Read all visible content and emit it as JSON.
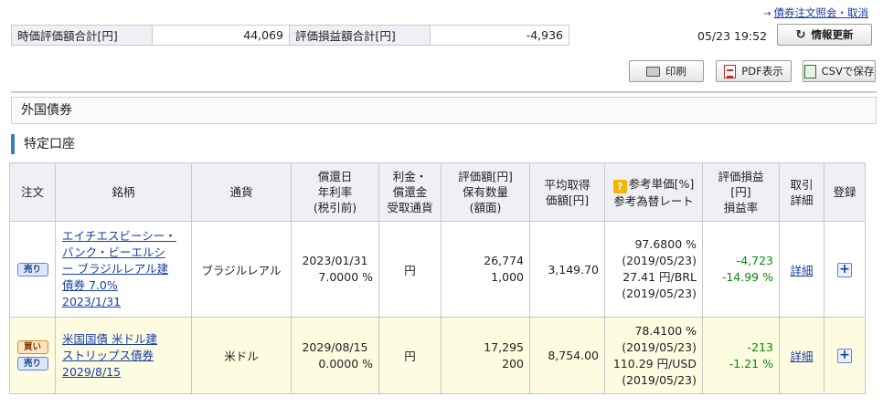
{
  "header": {
    "top_link": "債券注文照会・取消",
    "timestamp": "05/23 19:52",
    "refresh_label": "情報更新",
    "print_label": "印刷",
    "pdf_label": "PDF表示",
    "csv_label": "CSVで保存"
  },
  "summary": {
    "market_value_label": "時価評価額合計[円]",
    "market_value": "44,069",
    "pl_label": "評価損益額合計[円]",
    "pl_value": "-4,936"
  },
  "section_title": "外国債券",
  "account_title": "特定口座",
  "columns": {
    "order": "注文",
    "name": "銘柄",
    "currency": "通貨",
    "redemption_1": "償還日",
    "redemption_2": "年利率",
    "redemption_3": "(税引前)",
    "interest_1": "利金・",
    "interest_2": "償還金",
    "interest_3": "受取通貨",
    "value_1": "評価額[円]",
    "value_2": "保有数量",
    "value_3": "(額面)",
    "avg_1": "平均取得",
    "avg_2": "価額[円]",
    "ref_1": "参考単価[%]",
    "ref_2": "参考為替レート",
    "pl_1": "評価損益",
    "pl_2": "[円]",
    "pl_3": "損益率",
    "detail_1": "取引",
    "detail_2": "詳細",
    "register": "登録"
  },
  "rows": [
    {
      "sell_label": "売り",
      "name_lines": [
        "エイチエスビーシー・",
        "バンク・ビーエルシ",
        "ー ブラジルレアル建",
        "債券 7.0%",
        "2023/1/31"
      ],
      "currency": "ブラジルレアル",
      "redemption_date": "2023/01/31",
      "rate": "7.0000 %",
      "receive_currency": "円",
      "value": "26,774",
      "quantity": "1,000",
      "avg_price": "3,149.70",
      "ref_price": "97.6800 %",
      "ref_price_date": "(2019/05/23)",
      "fx_rate": "27.41 円/BRL",
      "fx_date": "(2019/05/23)",
      "pl": "-4,723",
      "pl_rate": "-14.99 %",
      "detail_label": "詳細",
      "register_label": "+"
    },
    {
      "buy_label": "買い",
      "sell_label": "売り",
      "name_lines": [
        "米国国債 米ドル建",
        "ストリップス債券",
        "2029/8/15"
      ],
      "currency": "米ドル",
      "redemption_date": "2029/08/15",
      "rate": "0.0000 %",
      "receive_currency": "円",
      "value": "17,295",
      "quantity": "200",
      "avg_price": "8,754.00",
      "ref_price": "78.4100 %",
      "ref_price_date": "(2019/05/23)",
      "fx_rate": "110.29 円/USD",
      "fx_date": "(2019/05/23)",
      "pl": "-213",
      "pl_rate": "-1.21 %",
      "detail_label": "詳細",
      "register_label": "+"
    }
  ]
}
